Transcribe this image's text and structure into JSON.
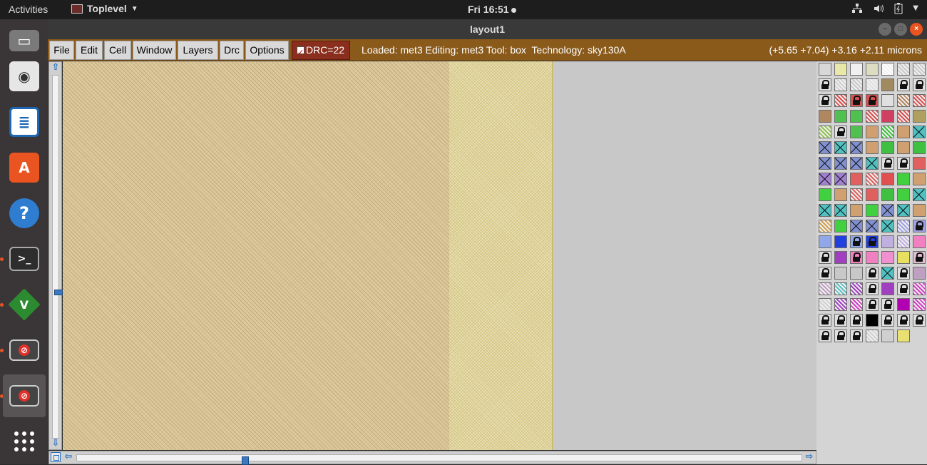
{
  "topbar": {
    "activities": "Activities",
    "app_name": "Toplevel",
    "clock": "Fri 16:51"
  },
  "dock": {
    "items": [
      {
        "name": "files",
        "icon": "file-cabinet-icon",
        "color": "#6d6d6d"
      },
      {
        "name": "rhythmbox",
        "icon": "speaker-icon",
        "color": "#e8e8e8"
      },
      {
        "name": "libreoffice-writer",
        "icon": "document-icon",
        "color": "#1e68b3"
      },
      {
        "name": "software-center",
        "icon": "shopping-bag-icon",
        "color": "#e95420"
      },
      {
        "name": "help",
        "icon": "question-icon",
        "color": "#2f7dd1"
      },
      {
        "name": "terminal",
        "icon": "terminal-icon",
        "color": "#333333"
      },
      {
        "name": "vim",
        "icon": "vim-icon",
        "color": "#2c8a30"
      },
      {
        "name": "tk-app-1",
        "icon": "no-entry-icon",
        "color": "#555555"
      },
      {
        "name": "tk-app-2",
        "icon": "no-entry-icon",
        "color": "#555555"
      },
      {
        "name": "show-applications",
        "icon": "grid-dots-icon",
        "color": "#ffffff"
      }
    ]
  },
  "window": {
    "title": "layout1"
  },
  "menubar": {
    "items": [
      "File",
      "Edit",
      "Cell",
      "Window",
      "Layers",
      "Drc",
      "Options"
    ],
    "drc_label": "DRC=22",
    "drc_checked": true,
    "status": "Loaded: met3 Editing: met3 Tool: box  Technology: sky130A",
    "coords": "(+5.65 +7.04) +3.16 +2.11 microns"
  },
  "colors": {
    "menubar_bg": "#8a5a1b",
    "drc_bg": "#8a2e1d",
    "metal_main": "#d8c59a",
    "metal_strip": "#e8e0b5",
    "canvas_bg": "#c8c8c8"
  },
  "scroll": {
    "vertical_position": 0.6,
    "horizontal_position": 0.23
  },
  "palette": {
    "rows": [
      [
        "d:#d8d8d8",
        "d:#e8e8a8",
        "d:#f0f0f0",
        "d:#dcdcc0",
        "h:#ffffff",
        "h:#c8c8c8",
        "h:#c8c8c8"
      ],
      [
        "l:#e0e0e0",
        "h:#d0d0d0",
        "h:#c8c8c8",
        "h:#e0e0e0",
        "d:#a08a60",
        "l:#e0e0e0",
        "l:#e0e0e0"
      ],
      [
        "l:#e0e0e0",
        "h:#d85050",
        "l:#d85050",
        "l:#d85050",
        "d:#e0e0e0",
        "h:#b08860",
        "h:#d85050"
      ],
      [
        "d:#b08860",
        "d:#50c050",
        "d:#50c050",
        "h:#d85050",
        "d:#d04060",
        "h:#d85050",
        "d:#b0a060"
      ],
      [
        "h:#90c050",
        "l:#e0e0e0",
        "d:#50c050",
        "d:#d0a070",
        "h:#40c040",
        "d:#d0a070",
        "x:#50c0c0"
      ],
      [
        "x:#8090d0",
        "x:#50c0c0",
        "x:#8090d0",
        "d:#d0a070",
        "d:#40c040",
        "d:#d0a070",
        "d:#40c040"
      ],
      [
        "x:#8090d0",
        "x:#8090d0",
        "x:#8090d0",
        "x:#50c0c0",
        "l:#e0e0e0",
        "l:#e0e0e0",
        "d:#e06060"
      ],
      [
        "x:#a080d0",
        "x:#a080d0",
        "d:#e06060",
        "h:#e06060",
        "d:#e05050",
        "d:#40d040",
        "d:#d0a070"
      ],
      [
        "d:#40d040",
        "d:#d0a070",
        "h:#e06060",
        "d:#e06060",
        "d:#40c040",
        "d:#40d040",
        "x:#50c0c0"
      ],
      [
        "x:#50c0c0",
        "x:#50c0c0",
        "d:#d0a070",
        "d:#40d040",
        "x:#8090d0",
        "x:#50c0c0",
        "d:#d0a070"
      ],
      [
        "h:#d0a050",
        "d:#40d040",
        "x:#8090d0",
        "x:#8090d0",
        "x:#50c0c0",
        "h:#a0a0e0",
        "l:#a0a0e0"
      ],
      [
        "d:#90a8e8",
        "d:#2040e0",
        "l:#90a8e8",
        "l:#2040e0",
        "d:#c0b0e0",
        "h:#c0b0e0",
        "d:#f080c0"
      ],
      [
        "l:#e0e0e0",
        "d:#a040c0",
        "l:#f080c0",
        "d:#f080c0",
        "d:#f090d0",
        "d:#e8e060",
        "l:#e0c0d0"
      ],
      [
        "l:#e0e0e0",
        "d:#c8c8c8",
        "d:#c8c8c8",
        "l:#e0e0e0",
        "x:#50c0c0",
        "l:#e0e0e0",
        "d:#c0a0c0"
      ],
      [
        "h:#c0a0c0",
        "h:#60c0c0",
        "h:#a040c0",
        "l:#e0e0e0",
        "d:#a040c0",
        "l:#e0e0e0",
        "h:#d040c0"
      ],
      [
        "h:#d0d0d0",
        "h:#a040c0",
        "h:#d040c0",
        "l:#e0e0e0",
        "l:#e0e0e0",
        "d:#b000b0",
        "h:#d040c0"
      ],
      [
        "l:#e0e0e0",
        "l:#e0e0e0",
        "l:#e0e0e0",
        "d:#000000",
        "l:#e0e0e0",
        "l:#e0e0e0",
        "l:#e0e0e0"
      ],
      [
        "l:#e0e0e0",
        "l:#e0e0e0",
        "l:#e0e0e0",
        "h:#d0d0d0",
        "d:#d0d0d0",
        "d:#e8e070"
      ]
    ]
  }
}
